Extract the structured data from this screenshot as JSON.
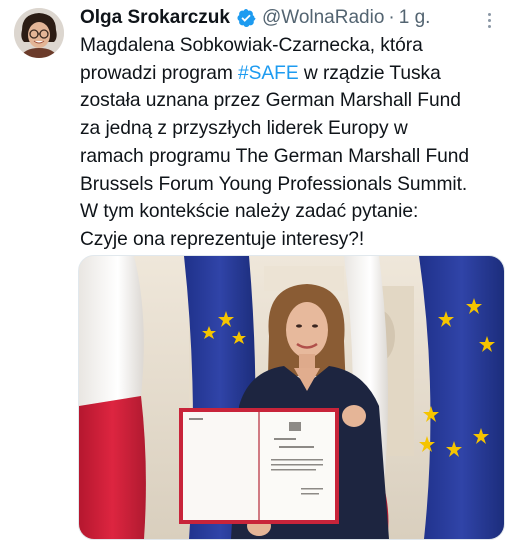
{
  "tweet": {
    "author_name": "Olga Srokarczuk",
    "author_handle": "@WolnaRadio",
    "separator": "·",
    "time": "1 g.",
    "text_lines": [
      {
        "before": "Magdalena Sobkowiak-Czarnecka, która",
        "hashtag": "",
        "after": ""
      },
      {
        "before": "prowadzi program ",
        "hashtag": "#SAFE",
        "after": " w rządzie Tuska"
      },
      {
        "before": "została uznana przez German Marshall Fund",
        "hashtag": "",
        "after": ""
      },
      {
        "before": "za jedną z przyszłych liderek Europy w",
        "hashtag": "",
        "after": ""
      },
      {
        "before": "ramach programu The German Marshall Fund",
        "hashtag": "",
        "after": ""
      },
      {
        "before": "Brussels Forum Young Professionals Summit.",
        "hashtag": "",
        "after": ""
      },
      {
        "before": "W tym kontekście należy zadać pytanie:",
        "hashtag": "",
        "after": ""
      },
      {
        "before": "Czyje ona reprezentuje interesy?!",
        "hashtag": "",
        "after": ""
      }
    ]
  },
  "icons": {
    "verified": "verified-badge-icon",
    "more": "more-options-icon"
  },
  "colors": {
    "text": "#0f1419",
    "muted": "#536471",
    "link": "#1d9bf0",
    "verified": "#1d9bf0",
    "eu_blue": "#2a3f9e",
    "eu_star": "#f5c400",
    "poland_red": "#d4213d"
  }
}
